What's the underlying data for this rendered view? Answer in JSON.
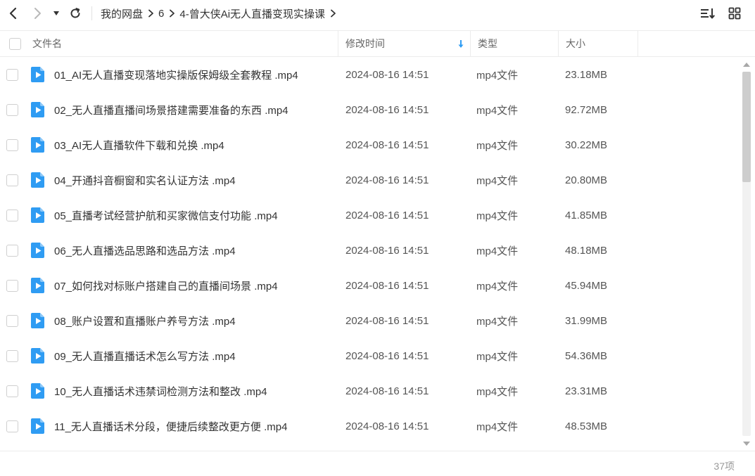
{
  "nav": {
    "breadcrumb": [
      "我的网盘",
      "6",
      "4-曾大侠Ai无人直播变现实操课"
    ]
  },
  "columns": {
    "name": "文件名",
    "modified": "修改时间",
    "type": "类型",
    "size": "大小"
  },
  "files": [
    {
      "name": "01_AI无人直播变现落地实操版保姆级全套教程 .mp4",
      "modified": "2024-08-16 14:51",
      "type": "mp4文件",
      "size": "23.18MB"
    },
    {
      "name": "02_无人直播直播间场景搭建需要准备的东西 .mp4",
      "modified": "2024-08-16 14:51",
      "type": "mp4文件",
      "size": "92.72MB"
    },
    {
      "name": "03_AI无人直播软件下载和兑换 .mp4",
      "modified": "2024-08-16 14:51",
      "type": "mp4文件",
      "size": "30.22MB"
    },
    {
      "name": "04_开通抖音橱窗和实名认证方法 .mp4",
      "modified": "2024-08-16 14:51",
      "type": "mp4文件",
      "size": "20.80MB"
    },
    {
      "name": "05_直播考试经营护航和买家微信支付功能 .mp4",
      "modified": "2024-08-16 14:51",
      "type": "mp4文件",
      "size": "41.85MB"
    },
    {
      "name": "06_无人直播选品思路和选品方法 .mp4",
      "modified": "2024-08-16 14:51",
      "type": "mp4文件",
      "size": "48.18MB"
    },
    {
      "name": "07_如何找对标账户搭建自己的直播间场景 .mp4",
      "modified": "2024-08-16 14:51",
      "type": "mp4文件",
      "size": "45.94MB"
    },
    {
      "name": "08_账户设置和直播账户养号方法 .mp4",
      "modified": "2024-08-16 14:51",
      "type": "mp4文件",
      "size": "31.99MB"
    },
    {
      "name": "09_无人直播直播话术怎么写方法 .mp4",
      "modified": "2024-08-16 14:51",
      "type": "mp4文件",
      "size": "54.36MB"
    },
    {
      "name": "10_无人直播话术违禁词检测方法和整改 .mp4",
      "modified": "2024-08-16 14:51",
      "type": "mp4文件",
      "size": "23.31MB"
    },
    {
      "name": "11_无人直播话术分段，便捷后续整改更方便 .mp4",
      "modified": "2024-08-16 14:51",
      "type": "mp4文件",
      "size": "48.53MB"
    }
  ],
  "footer": {
    "count": "37项"
  },
  "colors": {
    "accent": "#2f9cf3",
    "text": "#333333",
    "muted": "#999999"
  },
  "icons": {
    "back": "chevron-left-icon",
    "forward": "chevron-right-icon",
    "dropdown": "caret-down-icon",
    "refresh": "refresh-icon",
    "sort": "sort-list-icon",
    "grid": "grid-view-icon",
    "file": "video-file-icon",
    "sort_dir": "sort-descending-arrow-icon"
  }
}
